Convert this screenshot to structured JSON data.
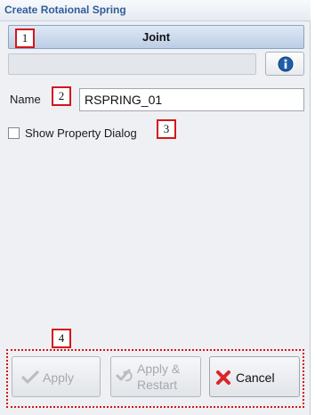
{
  "window": {
    "title": "Create Rotaional Spring"
  },
  "header": {
    "joint_label": "Joint"
  },
  "callouts": [
    "1",
    "2",
    "3",
    "4"
  ],
  "form": {
    "name_label": "Name",
    "name_value": "RSPRING_01",
    "show_property_label": "Show Property Dialog",
    "show_property_checked": false
  },
  "buttons": {
    "apply": "Apply",
    "apply_restart_line1": "Apply &",
    "apply_restart_line2": "Restart",
    "cancel": "Cancel"
  },
  "colors": {
    "title_text": "#2f5d9a",
    "callout_border": "#d4161b",
    "info_icon": "#1f5fa8",
    "cancel_icon": "#d9262b"
  },
  "icons": [
    "info-icon",
    "checkmark-icon",
    "apply-restart-icon",
    "close-x-icon"
  ]
}
